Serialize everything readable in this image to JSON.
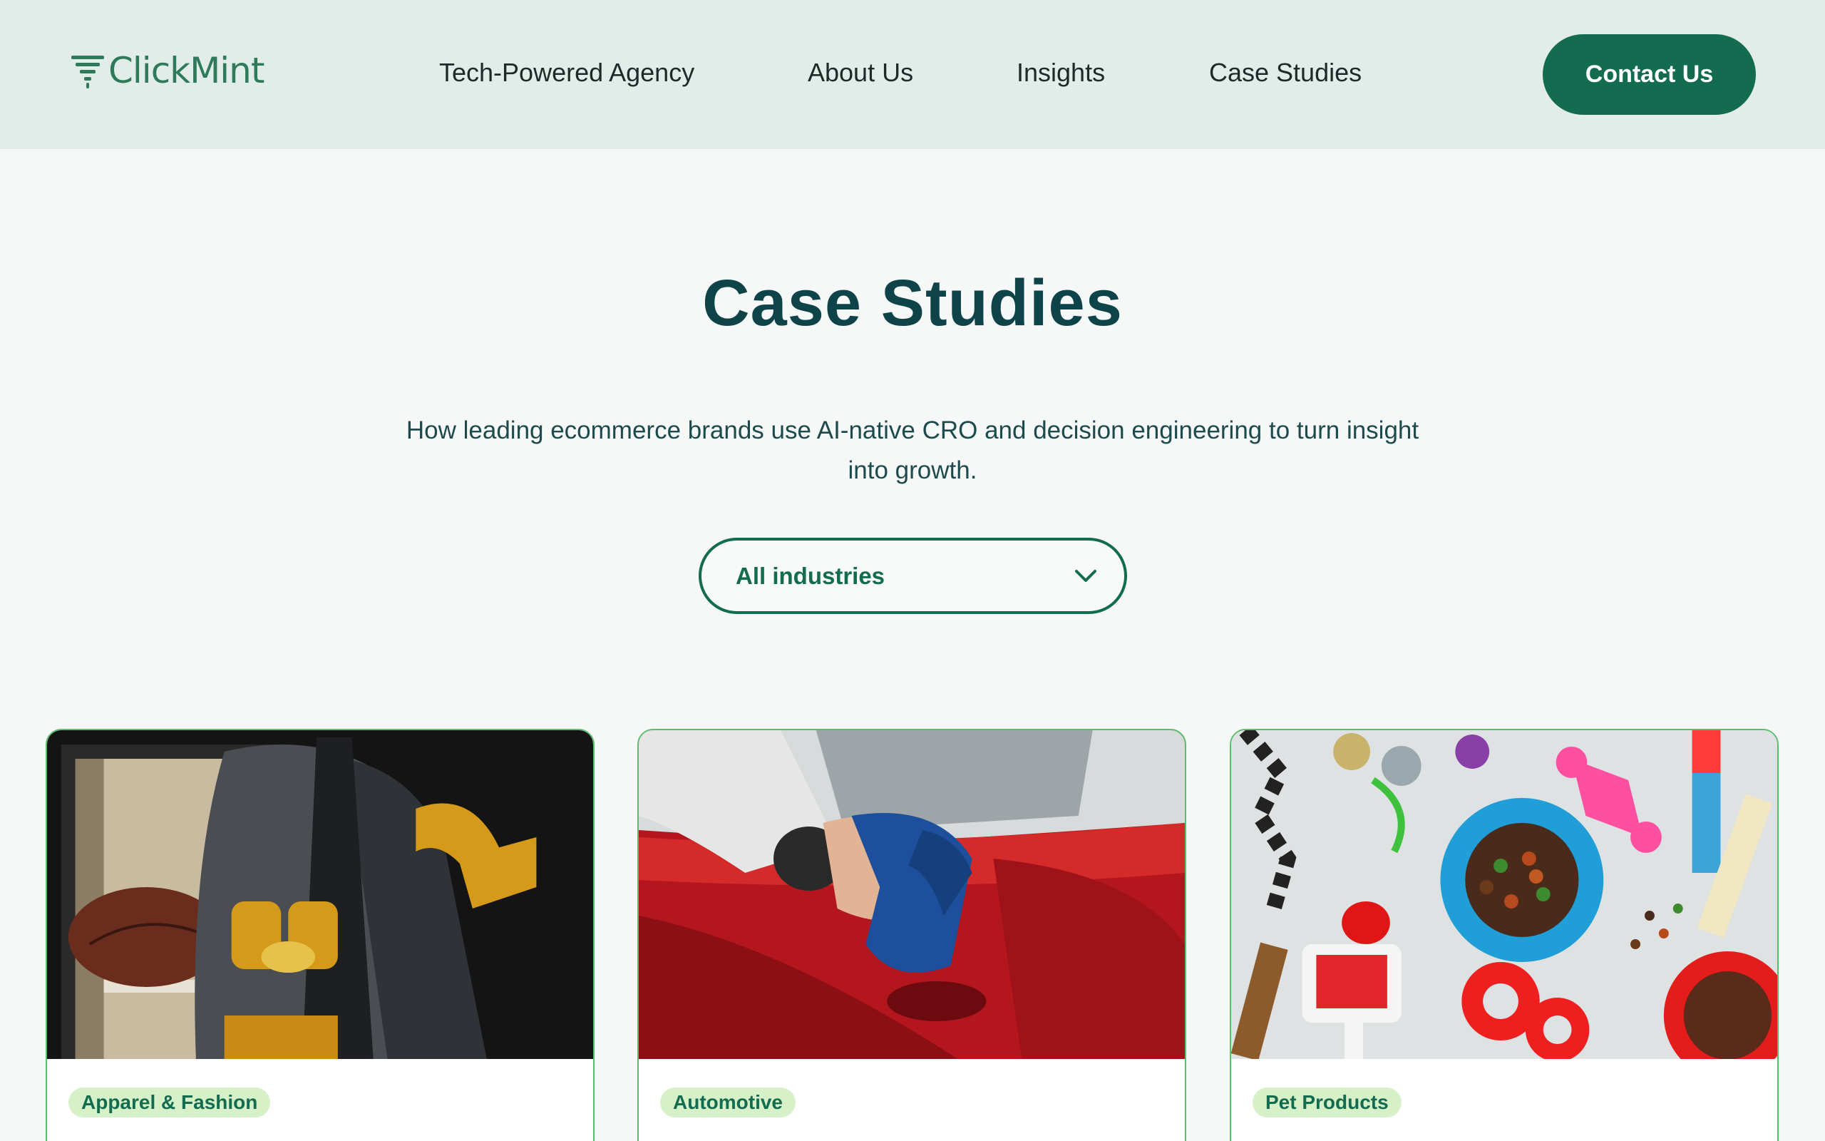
{
  "header": {
    "logo_text": "ClickMint",
    "nav": [
      {
        "label": "Tech-Powered Agency"
      },
      {
        "label": "About Us"
      },
      {
        "label": "Insights"
      },
      {
        "label": "Case Studies"
      }
    ],
    "cta_label": "Contact Us"
  },
  "hero": {
    "title": "Case Studies",
    "subtitle": "How leading ecommerce brands use AI-native CRO and decision engineering to turn insight into growth."
  },
  "filter": {
    "selected": "All industries",
    "icon": "chevron-down-icon"
  },
  "cards": [
    {
      "tag": "Apparel & Fashion",
      "image": "varsity-jacket-locker-photo"
    },
    {
      "tag": "Automotive",
      "image": "red-car-cleaning-photo"
    },
    {
      "tag": "Pet Products",
      "image": "pet-toys-food-bowls-photo"
    }
  ],
  "colors": {
    "brand_green": "#136b50",
    "header_bg": "#e2ede9",
    "title_color": "#0e4349",
    "tag_bg": "#d6f1c8",
    "card_border": "#5cbd6e"
  }
}
